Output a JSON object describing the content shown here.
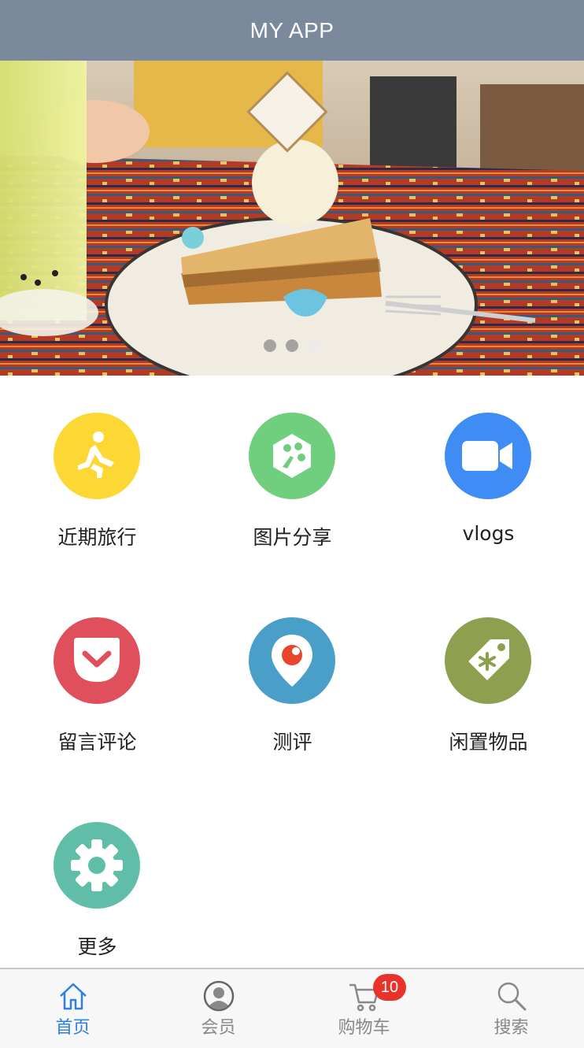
{
  "header": {
    "title": "MY APP"
  },
  "banner": {
    "slides": 3,
    "active_index": 2
  },
  "grid": {
    "items": [
      {
        "label": "近期旅行",
        "icon": "running-man-icon",
        "color": "#fdd835"
      },
      {
        "label": "图片分享",
        "icon": "frog-foot-icon",
        "color": "#6fcf7f"
      },
      {
        "label": "vlogs",
        "icon": "video-camera-icon",
        "color": "#3f8cf4"
      },
      {
        "label": "留言评论",
        "icon": "pocket-icon",
        "color": "#e0505c"
      },
      {
        "label": "测评",
        "icon": "map-pin-icon",
        "color": "#4a9fc8"
      },
      {
        "label": "闲置物品",
        "icon": "price-tag-icon",
        "color": "#8ea04f"
      },
      {
        "label": "更多",
        "icon": "gear-icon",
        "color": "#5fbda8"
      }
    ]
  },
  "tabbar": {
    "tabs": [
      {
        "label": "首页",
        "icon": "home-icon",
        "active": true
      },
      {
        "label": "会员",
        "icon": "user-icon",
        "active": false
      },
      {
        "label": "购物车",
        "icon": "cart-icon",
        "active": false,
        "badge": "10"
      },
      {
        "label": "搜索",
        "icon": "search-icon",
        "active": false
      }
    ]
  },
  "colors": {
    "header_bg": "#7a8a9c",
    "active_tab": "#2d7fe0",
    "badge": "#e8332b"
  }
}
